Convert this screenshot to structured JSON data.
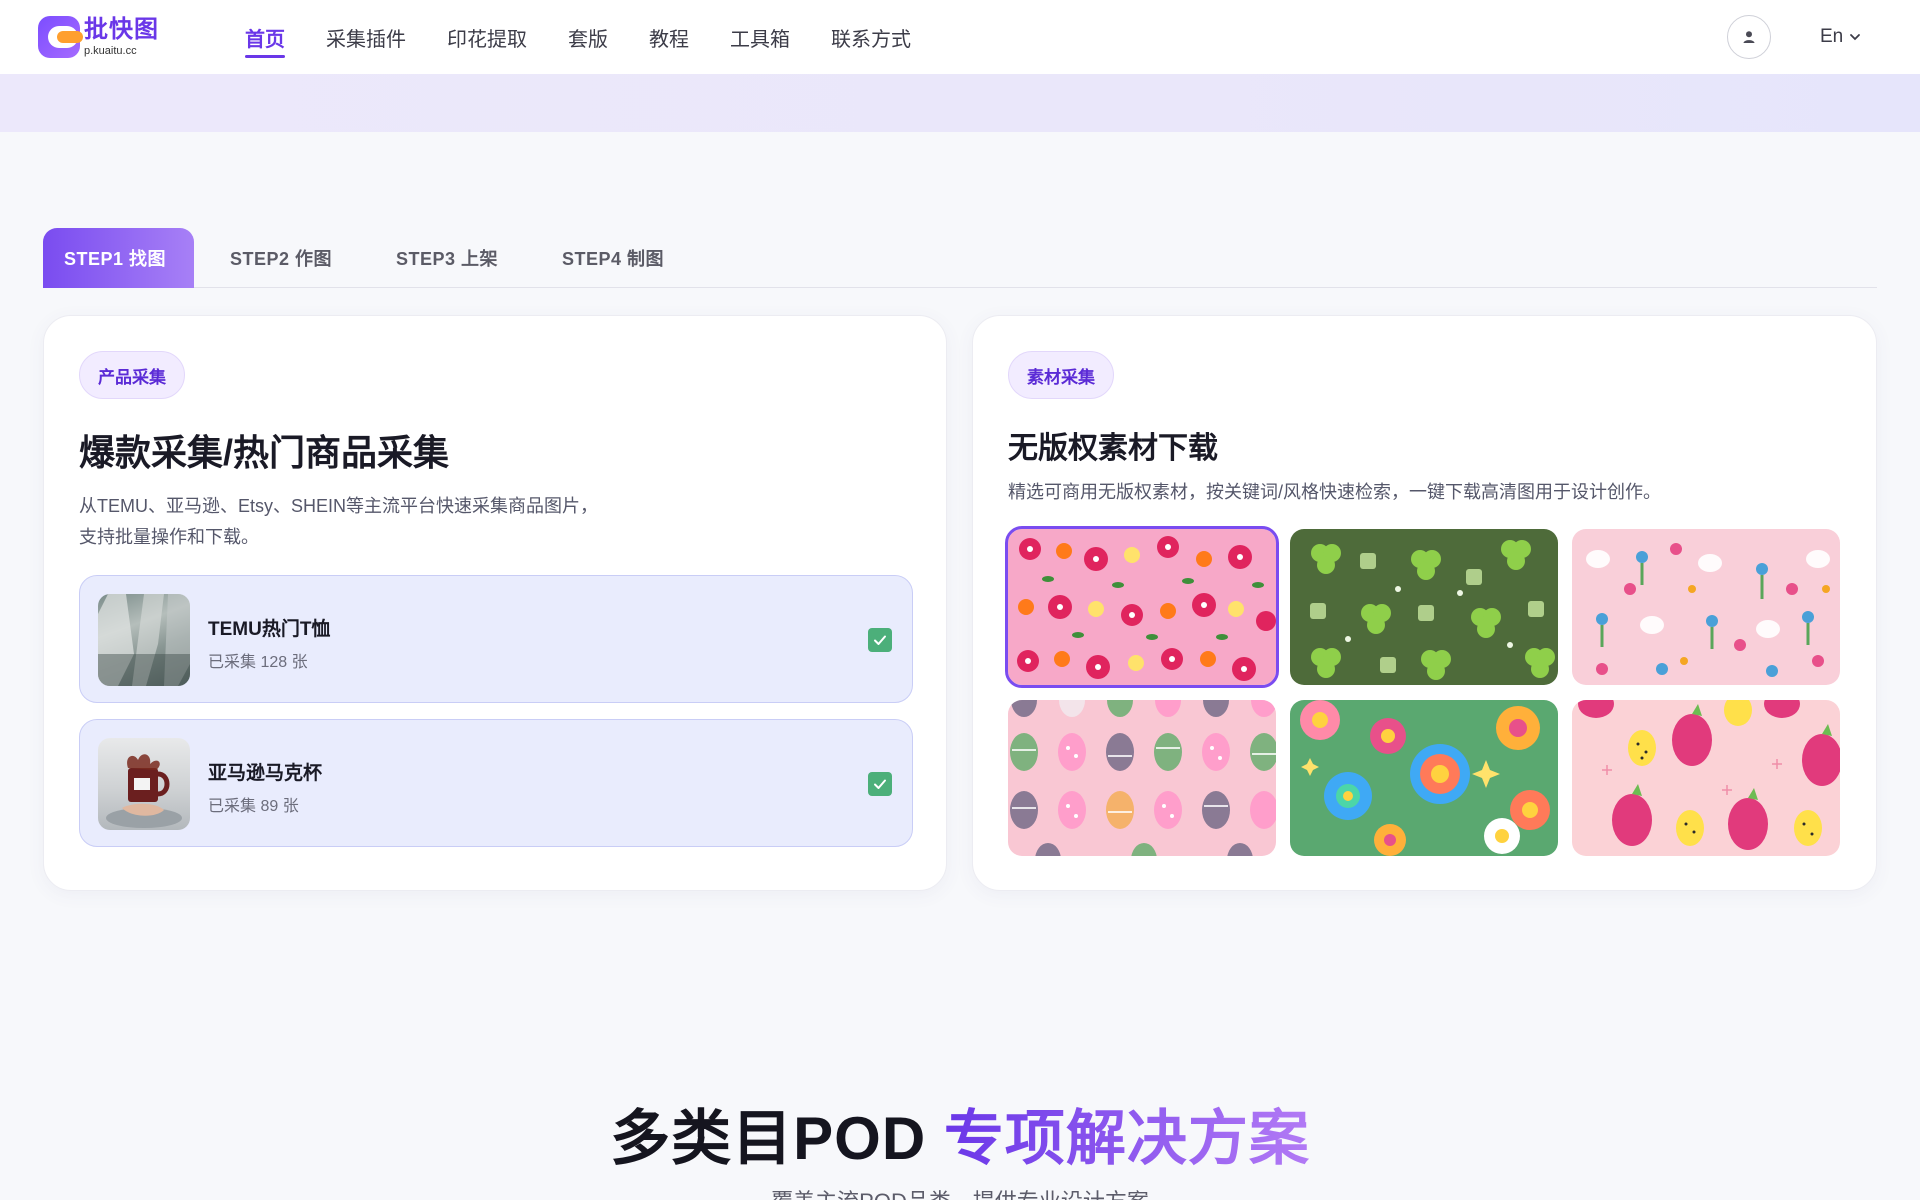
{
  "brand": {
    "name": "批快图",
    "domain": "p.kuaitu.cc"
  },
  "nav": {
    "items": [
      {
        "label": "首页",
        "active": true
      },
      {
        "label": "采集插件"
      },
      {
        "label": "印花提取"
      },
      {
        "label": "套版"
      },
      {
        "label": "教程"
      },
      {
        "label": "工具箱"
      },
      {
        "label": "联系方式"
      }
    ],
    "language": "En",
    "icons": {
      "user": "user-icon",
      "lang_chevron": "chevron-down-icon"
    }
  },
  "steps": {
    "tabs": [
      {
        "label": "STEP1 找图",
        "active": true
      },
      {
        "label": "STEP2 作图"
      },
      {
        "label": "STEP3 上架"
      },
      {
        "label": "STEP4 制图"
      }
    ]
  },
  "product_card": {
    "tag": "产品采集",
    "title": "爆款采集/热门商品采集",
    "description_line1": "从TEMU、亚马逊、Etsy、SHEIN等主流平台快速采集商品图片，",
    "description_line2": "支持批量操作和下载。",
    "items": [
      {
        "name": "TEMU热门T恤",
        "count": "已采集 128 张",
        "checked": true,
        "thumb": "tshirt-photo"
      },
      {
        "name": "亚马逊马克杯",
        "count": "已采集 89 张",
        "checked": true,
        "thumb": "mug-photo"
      }
    ]
  },
  "material_card": {
    "tag": "素材采集",
    "title": "无版权素材下载",
    "description": "精选可商用无版权素材，按关键词/风格快速检索，一键下载高清图用于设计创作。",
    "patterns": [
      {
        "name": "pink-flower-pattern",
        "selected": true
      },
      {
        "name": "green-clover-pattern"
      },
      {
        "name": "pink-bunny-flower-pattern"
      },
      {
        "name": "easter-egg-pattern"
      },
      {
        "name": "retro-flower-pattern"
      },
      {
        "name": "dragon-fruit-pattern"
      }
    ]
  },
  "solutions": {
    "title_main": "多类目POD",
    "title_accent": "专项解决方案",
    "subtitle": "覆盖主流POD品类，提供专业设计方案"
  },
  "colors": {
    "accent": "#6a37e8",
    "tab_gradient_end": "#a780f6",
    "check": "#4caf7a"
  }
}
